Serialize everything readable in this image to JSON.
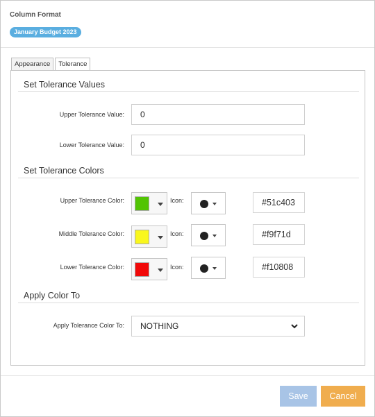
{
  "dialog": {
    "title": "Column Format",
    "context_badge": "January Budget 2023"
  },
  "tabs": [
    {
      "label": "Appearance",
      "active": false
    },
    {
      "label": "Tolerance",
      "active": true
    }
  ],
  "tolerance_values": {
    "section_title": "Set Tolerance Values",
    "upper_label": "Upper Tolerance Value:",
    "upper_value": "0",
    "lower_label": "Lower Tolerance Value:",
    "lower_value": "0"
  },
  "tolerance_colors": {
    "section_title": "Set Tolerance Colors",
    "icon_label": "Icon:",
    "rows": [
      {
        "label": "Upper Tolerance Color:",
        "color": "#51c403",
        "hex": "#51c403",
        "icon": "circle-icon"
      },
      {
        "label": "Middle Tolerance Color:",
        "color": "#f9f71d",
        "hex": "#f9f71d",
        "icon": "circle-icon"
      },
      {
        "label": "Lower Tolerance Color:",
        "color": "#f10808",
        "hex": "#f10808",
        "icon": "circle-icon"
      }
    ]
  },
  "apply_color": {
    "section_title": "Apply Color To",
    "label": "Apply Tolerance Color To:",
    "selected": "NOTHING"
  },
  "footer": {
    "save_label": "Save",
    "cancel_label": "Cancel"
  },
  "colors": {
    "badge": "#5aaee0",
    "save_button": "#a8c4e6",
    "cancel_button": "#f0ad4e"
  }
}
